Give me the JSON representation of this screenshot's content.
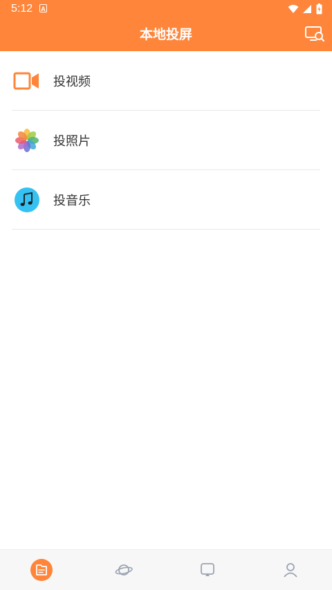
{
  "status_bar": {
    "time": "5:12",
    "notification_icon": "A",
    "icons": [
      "wifi-icon",
      "cellular-signal-icon",
      "battery-icon"
    ]
  },
  "app_bar": {
    "title": "本地投屏",
    "action_icon": "screen-search-icon"
  },
  "menu": {
    "items": [
      {
        "label": "投视频",
        "icon": "video-camera-icon"
      },
      {
        "label": "投照片",
        "icon": "photos-flower-icon"
      },
      {
        "label": "投音乐",
        "icon": "music-note-icon"
      }
    ]
  },
  "bottom_nav": {
    "tabs": [
      {
        "name": "local",
        "icon": "files-icon",
        "active": true
      },
      {
        "name": "discover",
        "icon": "planet-icon",
        "active": false
      },
      {
        "name": "cast",
        "icon": "cast-screen-icon",
        "active": false
      },
      {
        "name": "profile",
        "icon": "person-icon",
        "active": false
      }
    ]
  },
  "colors": {
    "accent": "#fe853a",
    "music_icon_bg": "#35c1f1",
    "nav_inactive": "#9aa3b2",
    "divider": "#e8e8e8"
  }
}
